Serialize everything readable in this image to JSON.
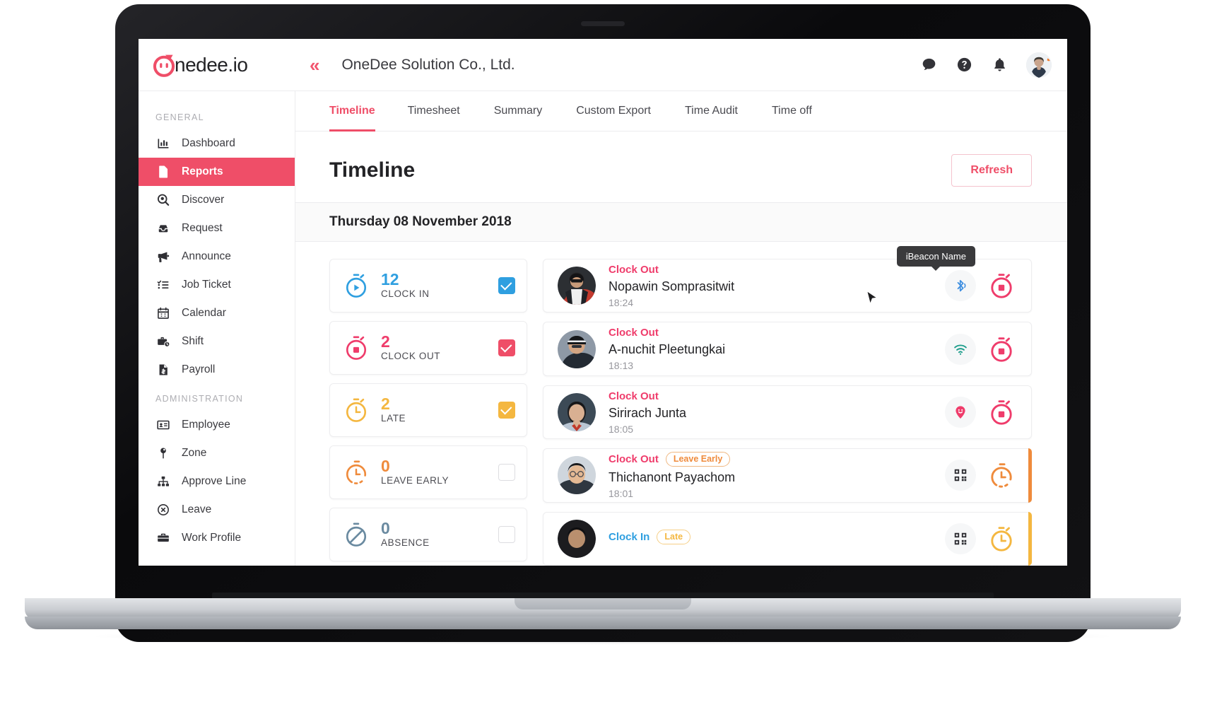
{
  "brand": {
    "logo_text": "nedee.io",
    "accent": "#ef4e68",
    "blue": "#2f9fe0",
    "yellow": "#f4b740",
    "orange": "#ef8b3c",
    "slate": "#6a8aa0",
    "teal": "#1f9e8c"
  },
  "topbar": {
    "collapse_icon": "«",
    "company_title": "OneDee Solution Co., Ltd.",
    "icons": [
      {
        "name": "chat-icon",
        "glyph": "chat"
      },
      {
        "name": "help-icon",
        "glyph": "help"
      },
      {
        "name": "bell-icon",
        "glyph": "bell"
      }
    ],
    "avatar_label": "User avatar"
  },
  "sidebar": {
    "sections": [
      {
        "label": "GENERAL",
        "items": [
          {
            "label": "Dashboard",
            "icon": "bar-chart-icon",
            "active": false
          },
          {
            "label": "Reports",
            "icon": "document-icon",
            "active": true
          },
          {
            "label": "Discover",
            "icon": "search-pin-icon",
            "active": false
          },
          {
            "label": "Request",
            "icon": "inbox-icon",
            "active": false
          },
          {
            "label": "Announce",
            "icon": "megaphone-icon",
            "active": false
          },
          {
            "label": "Job Ticket",
            "icon": "checklist-icon",
            "active": false
          },
          {
            "label": "Calendar",
            "icon": "calendar-icon",
            "active": false
          },
          {
            "label": "Shift",
            "icon": "briefcase-clock-icon",
            "active": false
          },
          {
            "label": "Payroll",
            "icon": "payroll-icon",
            "active": false
          }
        ]
      },
      {
        "label": "ADMINISTRATION",
        "items": [
          {
            "label": "Employee",
            "icon": "id-card-icon",
            "active": false
          },
          {
            "label": "Zone",
            "icon": "map-pin-icon",
            "active": false
          },
          {
            "label": "Approve Line",
            "icon": "hierarchy-icon",
            "active": false
          },
          {
            "label": "Leave",
            "icon": "x-circle-icon",
            "active": false
          },
          {
            "label": "Work Profile",
            "icon": "suitcase-icon",
            "active": false
          }
        ]
      }
    ]
  },
  "tabs": [
    {
      "label": "Timeline",
      "active": true
    },
    {
      "label": "Timesheet",
      "active": false
    },
    {
      "label": "Summary",
      "active": false
    },
    {
      "label": "Custom Export",
      "active": false
    },
    {
      "label": "Time Audit",
      "active": false
    },
    {
      "label": "Time off",
      "active": false
    }
  ],
  "page": {
    "title": "Timeline",
    "refresh_label": "Refresh",
    "date_label": "Thursday 08 November 2018"
  },
  "stats": [
    {
      "value": "12",
      "label": "CLOCK IN",
      "icon": "stopwatch-play-icon",
      "color": "#2f9fe0",
      "checked": true,
      "check_color": "#2f9fe0"
    },
    {
      "value": "2",
      "label": "CLOCK OUT",
      "icon": "stopwatch-stop-icon",
      "color": "#ef3c6b",
      "checked": true,
      "check_color": "#ef4e68"
    },
    {
      "value": "2",
      "label": "LATE",
      "icon": "stopwatch-late-icon",
      "color": "#f4b740",
      "checked": true,
      "check_color": "#f4b740"
    },
    {
      "value": "0",
      "label": "LEAVE EARLY",
      "icon": "stopwatch-early-icon",
      "color": "#ef8b3c",
      "checked": false,
      "check_color": "#ef8b3c"
    },
    {
      "value": "0",
      "label": "ABSENCE",
      "icon": "stopwatch-absent-icon",
      "color": "#6a8aa0",
      "checked": false,
      "check_color": "#6a8aa0"
    }
  ],
  "timeline": {
    "tooltip": "iBeacon Name",
    "entries": [
      {
        "type": "Clock Out",
        "type_color": "#ef3c6b",
        "badge": null,
        "name": "Nopawin Somprasitwit",
        "time": "18:24",
        "source_icon": "bluetooth-icon",
        "source_color": "#3d8ee0",
        "status_icon": "stopwatch-stop-icon",
        "status_color": "#ef3c6b",
        "flag": null
      },
      {
        "type": "Clock Out",
        "type_color": "#ef3c6b",
        "badge": null,
        "name": "A-nuchit Pleetungkai",
        "time": "18:13",
        "source_icon": "wifi-icon",
        "source_color": "#1f9e8c",
        "status_icon": "stopwatch-stop-icon",
        "status_color": "#ef3c6b",
        "flag": null
      },
      {
        "type": "Clock Out",
        "type_color": "#ef3c6b",
        "badge": null,
        "name": "Sirirach Junta",
        "time": "18:05",
        "source_icon": "map-pin-smile-icon",
        "source_color": "#ef3c6b",
        "status_icon": "stopwatch-stop-icon",
        "status_color": "#ef3c6b",
        "flag": null
      },
      {
        "type": "Clock Out",
        "type_color": "#ef3c6b",
        "badge": {
          "label": "Leave Early",
          "color": "#ef8b3c"
        },
        "name": "Thichanont Payachom",
        "time": "18:01",
        "source_icon": "qr-code-icon",
        "source_color": "#2b2b30",
        "status_icon": "stopwatch-early-icon",
        "status_color": "#ef8b3c",
        "flag": "#ef8b3c"
      },
      {
        "type": "Clock In",
        "type_color": "#2f9fe0",
        "badge": {
          "label": "Late",
          "color": "#f4b740"
        },
        "name": "",
        "time": "",
        "source_icon": "qr-code-icon",
        "source_color": "#2b2b30",
        "status_icon": "stopwatch-late-icon",
        "status_color": "#f4b740",
        "flag": "#f4b740"
      }
    ]
  }
}
